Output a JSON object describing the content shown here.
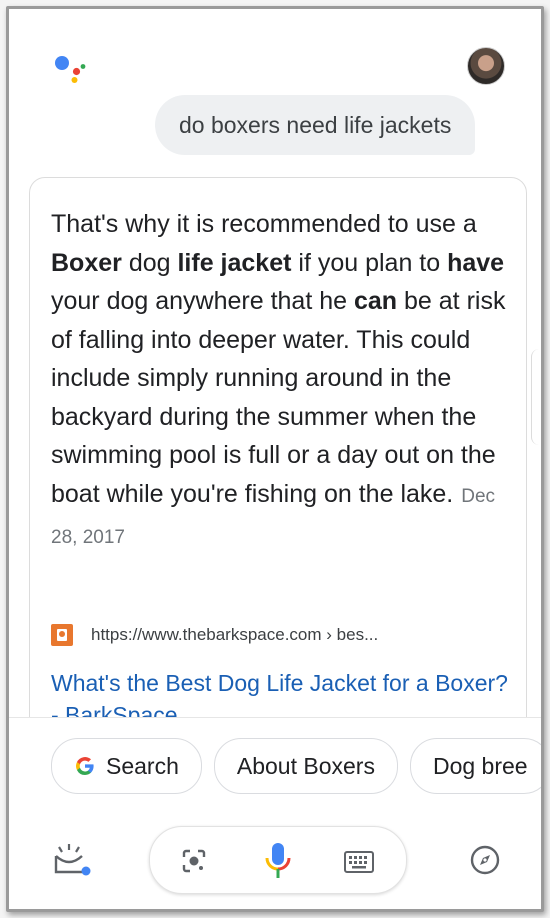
{
  "query": {
    "text": "do boxers need life jackets"
  },
  "answer": {
    "t1": "That's why it is recommended to use a ",
    "b1": "Boxer",
    "t2": " dog ",
    "b2": "life jacket",
    "t3": " if you plan to ",
    "b3": "have",
    "t4": " your dog anywhere that he ",
    "b4": "can",
    "t5": " be at risk of falling into deeper water. This could include simply running around in the backyard during the summer when the swimming pool is full or a day out on the boat while you're fishing on the lake.",
    "date": "Dec 28, 2017"
  },
  "source": {
    "url": "https://www.thebarkspace.com › bes...",
    "title": "What's the Best Dog Life Jacket for a Boxer? - BarkSpace"
  },
  "chips": [
    {
      "label": "Search"
    },
    {
      "label": "About Boxers"
    },
    {
      "label": "Dog bree"
    }
  ],
  "colors": {
    "google_blue": "#4285F4",
    "google_red": "#EA4335",
    "google_yellow": "#FBBC05",
    "google_green": "#34A853",
    "link": "#1a5fb4"
  },
  "icons": [
    "google-assistant-logo",
    "profile-avatar",
    "google-g-icon",
    "snapshot-icon",
    "lens-icon",
    "microphone-icon",
    "keyboard-icon",
    "compass-icon"
  ]
}
